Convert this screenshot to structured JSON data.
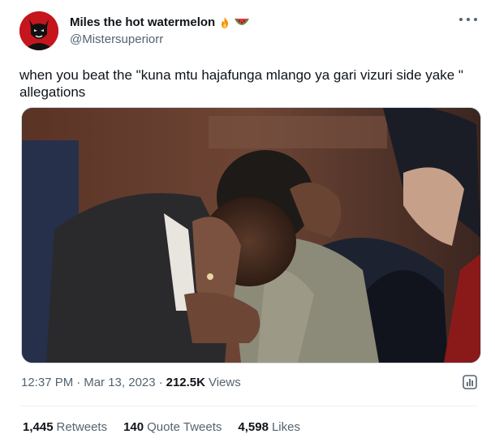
{
  "user": {
    "display_name": "Miles the hot watermelon",
    "handle": "@Mistersuperiorr",
    "emojis": [
      "fire-emoji",
      "watermelon-emoji"
    ]
  },
  "tweet": {
    "text": "when you beat the \"kuna mtu hajafunga mlango ya gari vizuri side yake \" allegations"
  },
  "meta": {
    "time": "12:37 PM",
    "separator": "·",
    "date": "Mar 13, 2023",
    "views_count": "212.5K",
    "views_label": "Views"
  },
  "stats": {
    "retweets_count": "1,445",
    "retweets_label": "Retweets",
    "quotes_count": "140",
    "quotes_label": "Quote Tweets",
    "likes_count": "4,598",
    "likes_label": "Likes"
  },
  "colors": {
    "text_primary": "#0f1419",
    "text_secondary": "#536471",
    "avatar_bg": "#b01818"
  }
}
